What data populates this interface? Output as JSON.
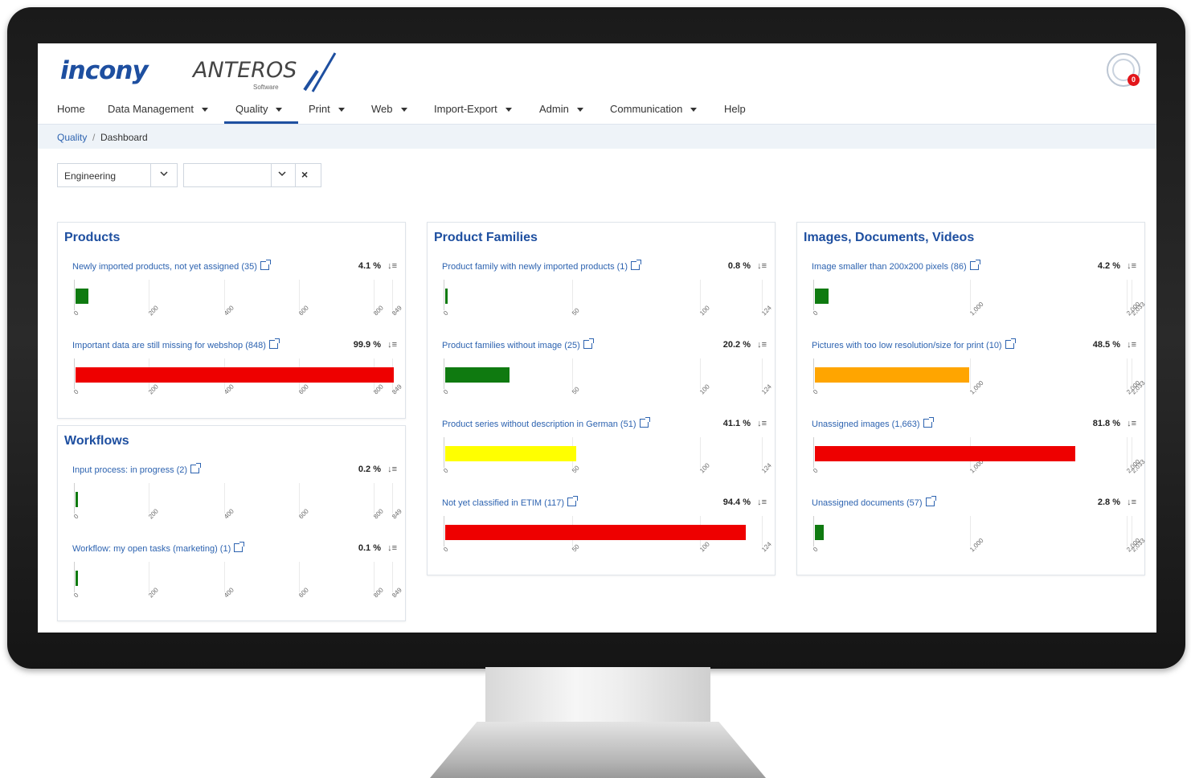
{
  "logos": {
    "brand1": "incony",
    "brand2": "ANTEROS",
    "brand2_sub": "Software"
  },
  "user": {
    "notifications": "0"
  },
  "nav": [
    {
      "label": "Home",
      "dropdown": false
    },
    {
      "label": "Data Management",
      "dropdown": true
    },
    {
      "label": "Quality",
      "dropdown": true,
      "active": true
    },
    {
      "label": "Print",
      "dropdown": true
    },
    {
      "label": "Web",
      "dropdown": true
    },
    {
      "label": "Import-Export",
      "dropdown": true
    },
    {
      "label": "Admin",
      "dropdown": true
    },
    {
      "label": "Communication",
      "dropdown": true
    },
    {
      "label": "Help",
      "dropdown": false
    }
  ],
  "breadcrumb": {
    "parent": "Quality",
    "separator": "/",
    "current": "Dashboard"
  },
  "filters": {
    "department": "Engineering",
    "secondary": ""
  },
  "colors": {
    "green": "#0f7a10",
    "red": "#ee0000",
    "yellow": "#ffff00",
    "orange": "#ffa500",
    "accent": "#1e4fa0"
  },
  "panels": {
    "products": {
      "title": "Products",
      "metrics": [
        {
          "label": "Newly imported products, not yet assigned (35)",
          "pct": "4.1 %",
          "value": 35,
          "color": "green",
          "ticks": [
            "0",
            "200",
            "400",
            "600",
            "800",
            "849"
          ]
        },
        {
          "label": "Important data are still missing for webshop (848)",
          "pct": "99.9 %",
          "value": 848,
          "color": "red",
          "ticks": [
            "0",
            "200",
            "400",
            "600",
            "800",
            "849"
          ]
        }
      ]
    },
    "workflows": {
      "title": "Workflows",
      "metrics": [
        {
          "label": "Input process: in progress (2)",
          "pct": "0.2 %",
          "value": 2,
          "color": "green",
          "ticks": [
            "0",
            "200",
            "400",
            "600",
            "800",
            "849"
          ]
        },
        {
          "label": "Workflow: my open tasks (marketing) (1)",
          "pct": "0.1 %",
          "value": 1,
          "color": "green",
          "ticks": [
            "0",
            "200",
            "400",
            "600",
            "800",
            "849"
          ]
        }
      ]
    },
    "families": {
      "title": "Product Families",
      "metrics": [
        {
          "label": "Product family with newly imported products (1)",
          "pct": "0.8 %",
          "value": 1,
          "color": "green",
          "ticks": [
            "0",
            "50",
            "100",
            "124"
          ]
        },
        {
          "label": "Product families without image (25)",
          "pct": "20.2 %",
          "value": 25,
          "color": "green",
          "ticks": [
            "0",
            "50",
            "100",
            "124"
          ]
        },
        {
          "label": "Product series without description in German (51)",
          "pct": "41.1 %",
          "value": 51,
          "color": "yellow",
          "ticks": [
            "0",
            "50",
            "100",
            "124"
          ]
        },
        {
          "label": "Not yet classified in ETIM (117)",
          "pct": "94.4 %",
          "value": 117,
          "color": "red",
          "ticks": [
            "0",
            "50",
            "100",
            "124"
          ]
        }
      ]
    },
    "media": {
      "title": "Images, Documents, Videos",
      "metrics": [
        {
          "label": "Image smaller than 200x200 pixels (86)",
          "pct": "4.2 %",
          "value": 86,
          "color": "green",
          "ticks": [
            "0",
            "1,000",
            "2,000",
            "2,033"
          ]
        },
        {
          "label": "Pictures with too low resolution/size for print (10)",
          "pct": "48.5 %",
          "value": 986,
          "color": "orange",
          "ticks": [
            "0",
            "1,000",
            "2,000",
            "2,033"
          ]
        },
        {
          "label": "Unassigned images (1,663)",
          "pct": "81.8 %",
          "value": 1663,
          "color": "red",
          "ticks": [
            "0",
            "1,000",
            "2,000",
            "2,033"
          ]
        },
        {
          "label": "Unassigned documents (57)",
          "pct": "2.8 %",
          "value": 57,
          "color": "green",
          "ticks": [
            "0",
            "1,000",
            "2,000",
            "2,033"
          ]
        }
      ]
    }
  }
}
